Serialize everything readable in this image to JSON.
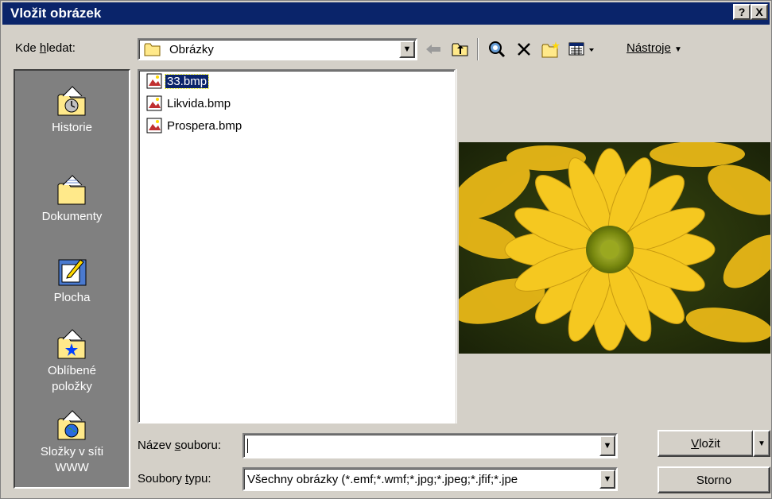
{
  "window": {
    "title": "Vložit obrázek",
    "help_label": "?",
    "close_label": "X"
  },
  "toolbar": {
    "look_in_label_pre": "Kde ",
    "look_in_label_u": "h",
    "look_in_label_post": "ledat:",
    "folder_value": "Obrázky",
    "tools_label": "Nástroje"
  },
  "places": [
    {
      "label": "Historie",
      "icon": "history-folder-icon"
    },
    {
      "label": "Dokumenty",
      "icon": "documents-folder-icon"
    },
    {
      "label": "Plocha",
      "icon": "desktop-icon"
    },
    {
      "label_line1": "Oblíbené",
      "label_line2": "položky",
      "icon": "favorites-folder-icon"
    },
    {
      "label_line1": "Složky v síti",
      "label_line2": "WWW",
      "icon": "web-folders-icon"
    }
  ],
  "files": [
    {
      "name": "33.bmp",
      "selected": true
    },
    {
      "name": "Likvida.bmp",
      "selected": false
    },
    {
      "name": "Prospera.bmp",
      "selected": false
    }
  ],
  "preview": {
    "description_icon": "yellow-flower-photo"
  },
  "filename": {
    "label_pre": "Název ",
    "label_u": "s",
    "label_post": "ouboru:",
    "value": ""
  },
  "filetype": {
    "label_pre": "Soubory ",
    "label_u": "t",
    "label_post": "ypu:",
    "value": "Všechny obrázky (*.emf;*.wmf;*.jpg;*.jpeg;*.jfif;*.jpe"
  },
  "buttons": {
    "insert_u": "V",
    "insert_rest": "ložit",
    "cancel": "Storno"
  },
  "colors": {
    "titlebar": "#0a246a",
    "face": "#d4d0c8",
    "places_bg": "#808080",
    "selection": "#0a246a"
  }
}
